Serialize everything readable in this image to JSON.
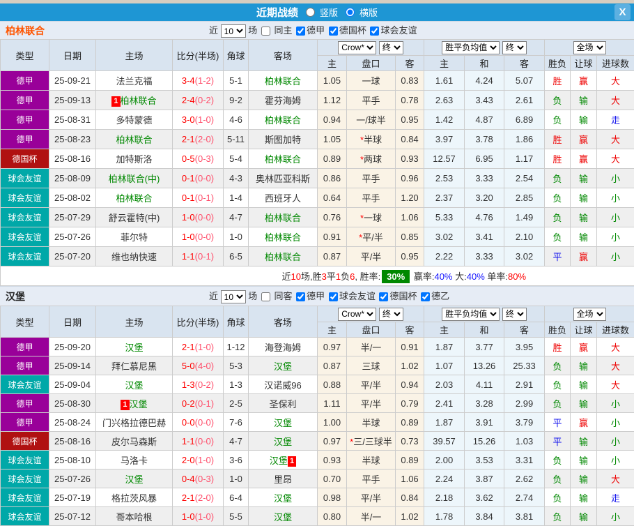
{
  "titlebar": {
    "title": "近期战绩",
    "radios": [
      {
        "label": "竖版",
        "checked": false
      },
      {
        "label": "横版",
        "checked": true
      }
    ],
    "close_label": "X"
  },
  "controls": {
    "near_label": "近",
    "games_value": "10",
    "games_suffix": "场",
    "company": "Crow*",
    "final": "终",
    "avg": "胜平负均值",
    "scope": "全场"
  },
  "columns": {
    "main": [
      "类型",
      "日期",
      "主场",
      "比分(半场)",
      "角球",
      "客场"
    ],
    "sub": [
      "主",
      "盘口",
      "客",
      "主",
      "和",
      "客",
      "胜负",
      "让球",
      "进球数"
    ]
  },
  "colors": {
    "type_map": {
      "德甲": "#990099",
      "德国杯": "#B01111",
      "球会友谊": "#00A8A8",
      "德乙": "#4466AA"
    },
    "result_map": {
      "胜": "#EE0000",
      "平": "#1414EE",
      "负": "#008800",
      "赢": "#EE0000",
      "输": "#008800",
      "走": "#1414EE",
      "大": "#EE0000",
      "小": "#008800"
    },
    "topbar": "#1E96D4",
    "team_green": "#008800",
    "score_red": "#FF0000"
  },
  "sections": [
    {
      "team": "柏林联合",
      "team_color": "#FF5500",
      "same_label": "同主",
      "same_checked": false,
      "leagues": [
        {
          "label": "德甲",
          "checked": true
        },
        {
          "label": "德国杯",
          "checked": true
        },
        {
          "label": "球会友谊",
          "checked": true
        }
      ],
      "rows": [
        {
          "type": "德甲",
          "date": "25-09-21",
          "home": "法兰克福",
          "hg": false,
          "hc": "",
          "score": "3-4",
          "half": "(1-2)",
          "corner": "5-1",
          "away": "柏林联合",
          "ag": true,
          "ac": "",
          "oh": "1.05",
          "hcap": "一球",
          "oa": "0.83",
          "aw": "1.61",
          "ad": "4.24",
          "al": "5.07",
          "r1": "胜",
          "r2": "赢",
          "r3": "大"
        },
        {
          "type": "德甲",
          "date": "25-09-13",
          "home": "柏林联合",
          "hg": true,
          "hc": "1",
          "score": "2-4",
          "half": "(0-2)",
          "corner": "9-2",
          "away": "霍芬海姆",
          "ag": false,
          "ac": "",
          "oh": "1.12",
          "hcap": "平手",
          "oa": "0.78",
          "aw": "2.63",
          "ad": "3.43",
          "al": "2.61",
          "r1": "负",
          "r2": "输",
          "r3": "大"
        },
        {
          "type": "德甲",
          "date": "25-08-31",
          "home": "多特蒙德",
          "hg": false,
          "hc": "",
          "score": "3-0",
          "half": "(1-0)",
          "corner": "4-6",
          "away": "柏林联合",
          "ag": true,
          "ac": "",
          "oh": "0.94",
          "hcap": "一/球半",
          "oa": "0.95",
          "aw": "1.42",
          "ad": "4.87",
          "al": "6.89",
          "r1": "负",
          "r2": "输",
          "r3": "走"
        },
        {
          "type": "德甲",
          "date": "25-08-23",
          "home": "柏林联合",
          "hg": true,
          "hc": "",
          "score": "2-1",
          "half": "(2-0)",
          "corner": "5-11",
          "away": "斯图加特",
          "ag": false,
          "ac": "",
          "oh": "1.05",
          "hcap": "*半球",
          "oa": "0.84",
          "aw": "3.97",
          "ad": "3.78",
          "al": "1.86",
          "r1": "胜",
          "r2": "赢",
          "r3": "大"
        },
        {
          "type": "德国杯",
          "date": "25-08-16",
          "home": "加特斯洛",
          "hg": false,
          "hc": "",
          "score": "0-5",
          "half": "(0-3)",
          "corner": "5-4",
          "away": "柏林联合",
          "ag": true,
          "ac": "",
          "oh": "0.89",
          "hcap": "*两球",
          "oa": "0.93",
          "aw": "12.57",
          "ad": "6.95",
          "al": "1.17",
          "r1": "胜",
          "r2": "赢",
          "r3": "大"
        },
        {
          "type": "球会友谊",
          "date": "25-08-09",
          "home": "柏林联合(中)",
          "hg": true,
          "hc": "",
          "score": "0-1",
          "half": "(0-0)",
          "corner": "4-3",
          "away": "奥林匹亚科斯",
          "ag": false,
          "ac": "",
          "oh": "0.86",
          "hcap": "平手",
          "oa": "0.96",
          "aw": "2.53",
          "ad": "3.33",
          "al": "2.54",
          "r1": "负",
          "r2": "输",
          "r3": "小"
        },
        {
          "type": "球会友谊",
          "date": "25-08-02",
          "home": "柏林联合",
          "hg": true,
          "hc": "",
          "score": "0-1",
          "half": "(0-1)",
          "corner": "1-4",
          "away": "西班牙人",
          "ag": false,
          "ac": "",
          "oh": "0.64",
          "hcap": "平手",
          "oa": "1.20",
          "aw": "2.37",
          "ad": "3.20",
          "al": "2.85",
          "r1": "负",
          "r2": "输",
          "r3": "小"
        },
        {
          "type": "球会友谊",
          "date": "25-07-29",
          "home": "舒云霍特(中)",
          "hg": false,
          "hc": "",
          "score": "1-0",
          "half": "(0-0)",
          "corner": "4-7",
          "away": "柏林联合",
          "ag": true,
          "ac": "",
          "oh": "0.76",
          "hcap": "*一球",
          "oa": "1.06",
          "aw": "5.33",
          "ad": "4.76",
          "al": "1.49",
          "r1": "负",
          "r2": "输",
          "r3": "小"
        },
        {
          "type": "球会友谊",
          "date": "25-07-26",
          "home": "菲尔特",
          "hg": false,
          "hc": "",
          "score": "1-0",
          "half": "(0-0)",
          "corner": "1-0",
          "away": "柏林联合",
          "ag": true,
          "ac": "",
          "oh": "0.91",
          "hcap": "*平/半",
          "oa": "0.85",
          "aw": "3.02",
          "ad": "3.41",
          "al": "2.10",
          "r1": "负",
          "r2": "输",
          "r3": "小"
        },
        {
          "type": "球会友谊",
          "date": "25-07-20",
          "home": "维也纳快速",
          "hg": false,
          "hc": "",
          "score": "1-1",
          "half": "(0-1)",
          "corner": "6-5",
          "away": "柏林联合",
          "ag": true,
          "ac": "",
          "oh": "0.87",
          "hcap": "平/半",
          "oa": "0.95",
          "aw": "2.22",
          "ad": "3.33",
          "al": "3.02",
          "r1": "平",
          "r2": "赢",
          "r3": "小"
        }
      ],
      "summary": [
        {
          "t": "近",
          "s": "k"
        },
        {
          "t": "10",
          "s": "r"
        },
        {
          "t": "场,胜",
          "s": "k"
        },
        {
          "t": "3",
          "s": "r"
        },
        {
          "t": "平",
          "s": "k"
        },
        {
          "t": "1",
          "s": "r"
        },
        {
          "t": "负",
          "s": "k"
        },
        {
          "t": "6",
          "s": "r"
        },
        {
          "t": ", 胜率:",
          "s": "k"
        },
        {
          "t": "30%",
          "s": "badge"
        },
        {
          "t": " 赢率:",
          "s": "k"
        },
        {
          "t": "40%",
          "s": "b"
        },
        {
          "t": " 大:",
          "s": "k"
        },
        {
          "t": "40%",
          "s": "b"
        },
        {
          "t": " 单率:",
          "s": "k"
        },
        {
          "t": "80%",
          "s": "r"
        }
      ]
    },
    {
      "team": "汉堡",
      "team_color": "#222222",
      "same_label": "同客",
      "same_checked": false,
      "leagues": [
        {
          "label": "德甲",
          "checked": true
        },
        {
          "label": "球会友谊",
          "checked": true
        },
        {
          "label": "德国杯",
          "checked": true
        },
        {
          "label": "德乙",
          "checked": true
        }
      ],
      "rows": [
        {
          "type": "德甲",
          "date": "25-09-20",
          "home": "汉堡",
          "hg": true,
          "hc": "",
          "score": "2-1",
          "half": "(1-0)",
          "corner": "1-12",
          "away": "海登海姆",
          "ag": false,
          "ac": "",
          "oh": "0.97",
          "hcap": "半/一",
          "oa": "0.91",
          "aw": "1.87",
          "ad": "3.77",
          "al": "3.95",
          "r1": "胜",
          "r2": "赢",
          "r3": "大"
        },
        {
          "type": "德甲",
          "date": "25-09-14",
          "home": "拜仁慕尼黑",
          "hg": false,
          "hc": "",
          "score": "5-0",
          "half": "(4-0)",
          "corner": "5-3",
          "away": "汉堡",
          "ag": true,
          "ac": "",
          "oh": "0.87",
          "hcap": "三球",
          "oa": "1.02",
          "aw": "1.07",
          "ad": "13.26",
          "al": "25.33",
          "r1": "负",
          "r2": "输",
          "r3": "大"
        },
        {
          "type": "球会友谊",
          "date": "25-09-04",
          "home": "汉堡",
          "hg": true,
          "hc": "",
          "score": "1-3",
          "half": "(0-2)",
          "corner": "1-3",
          "away": "汉诺威96",
          "ag": false,
          "ac": "",
          "oh": "0.88",
          "hcap": "平/半",
          "oa": "0.94",
          "aw": "2.03",
          "ad": "4.11",
          "al": "2.91",
          "r1": "负",
          "r2": "输",
          "r3": "大"
        },
        {
          "type": "德甲",
          "date": "25-08-30",
          "home": "汉堡",
          "hg": true,
          "hc": "1",
          "score": "0-2",
          "half": "(0-1)",
          "corner": "2-5",
          "away": "圣保利",
          "ag": false,
          "ac": "",
          "oh": "1.11",
          "hcap": "平/半",
          "oa": "0.79",
          "aw": "2.41",
          "ad": "3.28",
          "al": "2.99",
          "r1": "负",
          "r2": "输",
          "r3": "小"
        },
        {
          "type": "德甲",
          "date": "25-08-24",
          "home": "门兴格拉德巴赫",
          "hg": false,
          "hc": "",
          "score": "0-0",
          "half": "(0-0)",
          "corner": "7-6",
          "away": "汉堡",
          "ag": true,
          "ac": "",
          "oh": "1.00",
          "hcap": "半球",
          "oa": "0.89",
          "aw": "1.87",
          "ad": "3.91",
          "al": "3.79",
          "r1": "平",
          "r2": "赢",
          "r3": "小"
        },
        {
          "type": "德国杯",
          "date": "25-08-16",
          "home": "皮尔马森斯",
          "hg": false,
          "hc": "",
          "score": "1-1",
          "half": "(0-0)",
          "corner": "4-7",
          "away": "汉堡",
          "ag": true,
          "ac": "",
          "oh": "0.97",
          "hcap": "*三/三球半",
          "oa": "0.73",
          "aw": "39.57",
          "ad": "15.26",
          "al": "1.03",
          "r1": "平",
          "r2": "输",
          "r3": "小"
        },
        {
          "type": "球会友谊",
          "date": "25-08-10",
          "home": "马洛卡",
          "hg": false,
          "hc": "",
          "score": "2-0",
          "half": "(1-0)",
          "corner": "3-6",
          "away": "汉堡",
          "ag": true,
          "ac": "1",
          "oh": "0.93",
          "hcap": "半球",
          "oa": "0.89",
          "aw": "2.00",
          "ad": "3.53",
          "al": "3.31",
          "r1": "负",
          "r2": "输",
          "r3": "小"
        },
        {
          "type": "球会友谊",
          "date": "25-07-26",
          "home": "汉堡",
          "hg": true,
          "hc": "",
          "score": "0-4",
          "half": "(0-3)",
          "corner": "1-0",
          "away": "里昂",
          "ag": false,
          "ac": "",
          "oh": "0.70",
          "hcap": "平手",
          "oa": "1.06",
          "aw": "2.24",
          "ad": "3.87",
          "al": "2.62",
          "r1": "负",
          "r2": "输",
          "r3": "大"
        },
        {
          "type": "球会友谊",
          "date": "25-07-19",
          "home": "格拉茨风暴",
          "hg": false,
          "hc": "",
          "score": "2-1",
          "half": "(2-0)",
          "corner": "6-4",
          "away": "汉堡",
          "ag": true,
          "ac": "",
          "oh": "0.98",
          "hcap": "平/半",
          "oa": "0.84",
          "aw": "2.18",
          "ad": "3.62",
          "al": "2.74",
          "r1": "负",
          "r2": "输",
          "r3": "走"
        },
        {
          "type": "球会友谊",
          "date": "25-07-12",
          "home": "哥本哈根",
          "hg": false,
          "hc": "",
          "score": "1-0",
          "half": "(1-0)",
          "corner": "5-5",
          "away": "汉堡",
          "ag": true,
          "ac": "",
          "oh": "0.80",
          "hcap": "半/一",
          "oa": "1.02",
          "aw": "1.78",
          "ad": "3.84",
          "al": "3.81",
          "r1": "负",
          "r2": "输",
          "r3": "小"
        }
      ],
      "summary": null
    }
  ]
}
